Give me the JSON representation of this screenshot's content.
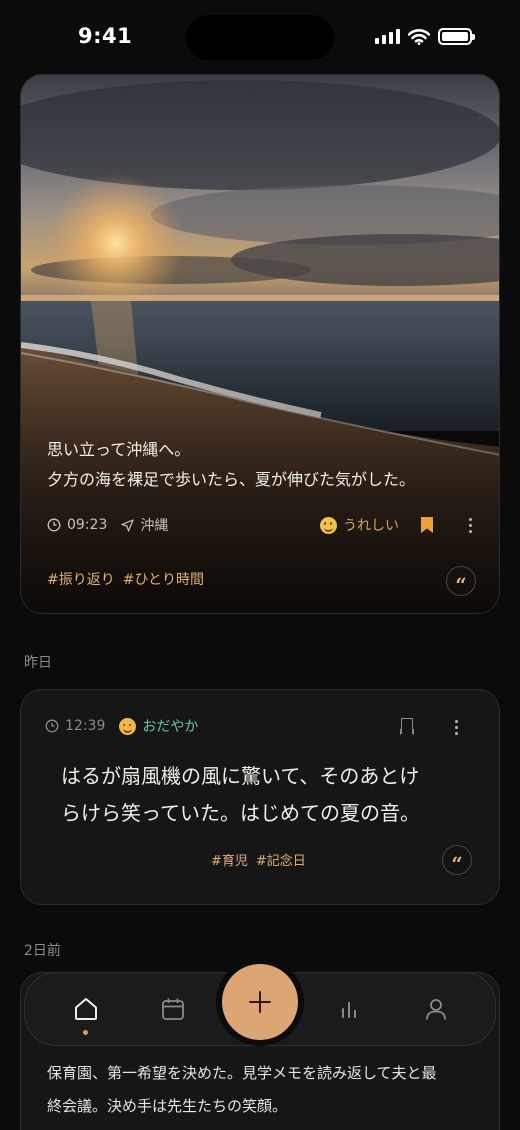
{
  "status_bar": {
    "time": "9:41"
  },
  "hero": {
    "text_line1": "思い立って沖縄へ。",
    "text_line2": "夕方の海を裸足で歩いたら、夏が伸びた気がした。",
    "time": "09:23",
    "location": "沖縄",
    "mood": "うれしい",
    "tags": [
      "#振り返り",
      "#ひとり時間"
    ],
    "quote_glyph": "“"
  },
  "sections": {
    "yesterday": "昨日",
    "two_days_ago": "2日前"
  },
  "entry": {
    "time": "12:39",
    "mood": "おだやか",
    "text_line1": "はるが扇風機の風に驚いて、そのあとけ",
    "text_line2": "らけら笑っていた。はじめての夏の音。",
    "tags": [
      "#育児",
      "#記念日"
    ],
    "quote_glyph": "“"
  },
  "entry2": {
    "text_line1": "保育園、第一希望を決めた。見学メモを読み返して夫と最",
    "text_line2": "終会議。決め手は先生たちの笑顔。"
  },
  "nav": {
    "items": [
      "home-icon",
      "calendar-icon",
      "add-icon",
      "stats-icon",
      "profile-icon"
    ],
    "active": "home-icon",
    "accent": "#dca574"
  },
  "colors": {
    "background": "#0b0b0c",
    "accent": "#e2b07a",
    "calm": "#67c2a4",
    "happy": "#d9a45c"
  }
}
